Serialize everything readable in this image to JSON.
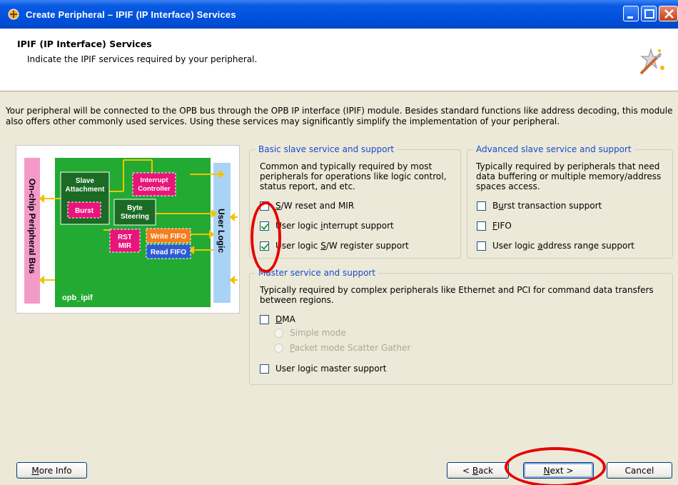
{
  "window": {
    "title": "Create Peripheral – IPIF (IP Interface) Services"
  },
  "header": {
    "title": "IPIF (IP Interface) Services",
    "subtitle": "Indicate the IPIF services required by your peripheral."
  },
  "intro": "Your peripheral will be connected to the OPB bus through the OPB IP interface (IPIF) module. Besides standard functions like address decoding, this module also offers other commonly used services. Using these services may significantly simplify the implementation of your peripheral.",
  "diagram": {
    "left_bus_label": "On-chip Peripheral Bus",
    "right_label": "User Logic",
    "module_label": "opb_ipif",
    "blocks": {
      "slave_attachment": "Slave Attachment",
      "burst": "Burst",
      "interrupt_controller": "Interrupt Controller",
      "byte_steering": "Byte Steering",
      "rst_mir": "RST MIR",
      "write_fifo": "Write FIFO",
      "read_fifo": "Read FIFO"
    },
    "colors": {
      "module": "#22aa33",
      "bus": "#f49ac9",
      "user_logic": "#a9d3f5",
      "magenta": "#e8157a",
      "orange": "#f57c20",
      "blue": "#2d5bd4"
    }
  },
  "basic": {
    "legend": "Basic slave service and support",
    "description": "Common and typically required by most peripherals for operations like logic control, status report, and etc.",
    "options": [
      {
        "label": "S/W reset and MIR",
        "checked": false
      },
      {
        "label": "User logic interrupt support",
        "checked": true
      },
      {
        "label": "User logic S/W register support",
        "checked": true
      }
    ]
  },
  "advanced": {
    "legend": "Advanced slave service and support",
    "description": "Typically required by peripherals that need data buffering or multiple memory/address spaces access.",
    "options": [
      {
        "label": "Burst transaction support",
        "checked": false
      },
      {
        "label": "FIFO",
        "checked": false
      },
      {
        "label": "User logic address range support",
        "checked": false
      }
    ]
  },
  "master": {
    "legend": "Master service and support",
    "description": "Typically required by complex peripherals like Ethernet and PCI for command data transfers between regions.",
    "dma_label": "DMA",
    "radio_simple": "Simple mode",
    "radio_packet": "Packet mode Scatter Gather",
    "master_support_label": "User logic master support"
  },
  "buttons": {
    "more_info": "More Info",
    "back": "< Back",
    "next": "Next >",
    "cancel": "Cancel"
  }
}
